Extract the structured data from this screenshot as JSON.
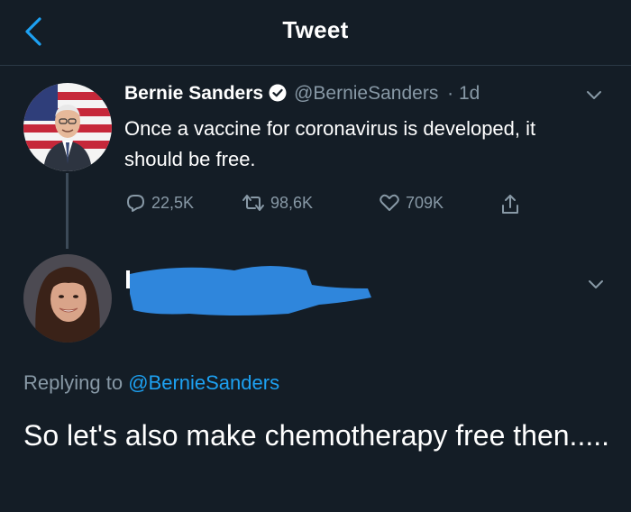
{
  "header": {
    "title": "Tweet",
    "back_icon": "chevron-left-icon"
  },
  "tweet": {
    "author_name": "Bernie Sanders",
    "verified": true,
    "handle": "@BernieSanders",
    "meta": "· 1d",
    "text": "Once a vaccine for coronavirus is developed, it should be free.",
    "replies": "22,5K",
    "retweets": "98,6K",
    "likes": "709K"
  },
  "reply": {
    "author_name_redacted": true,
    "replying_to_label": "Replying to",
    "replying_to_handle": "@BernieSanders",
    "text": "So let's also make chemotherapy free then....."
  },
  "colors": {
    "background": "#141d26",
    "accent": "#1da1f2",
    "muted": "#8899a6",
    "redaction": "#2f86dc"
  }
}
